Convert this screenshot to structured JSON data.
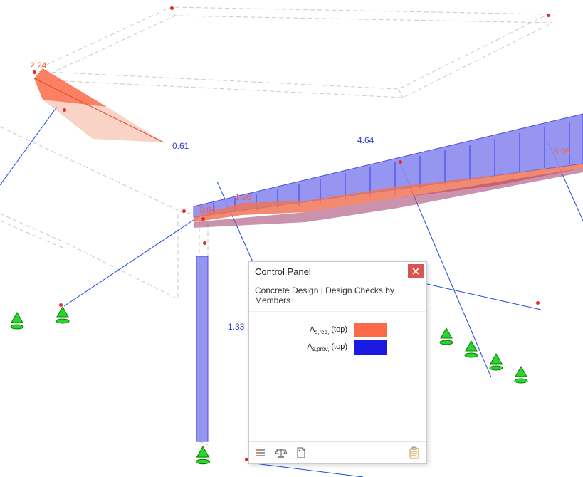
{
  "panel": {
    "title": "Control Panel",
    "subtitle": "Concrete Design | Design Checks by Members",
    "legend": [
      {
        "label": "As,req, (top)",
        "color": "#fc6a48"
      },
      {
        "label": "As,prov, (top)",
        "color": "#1a1ae0"
      }
    ],
    "footer_icons": [
      "list-icon",
      "balance-icon",
      "document-icon",
      "clipboard-icon"
    ]
  },
  "values": {
    "v224": "2.24",
    "v061": "0.61",
    "v004": "0.04",
    "v126": "1.26",
    "v464": "4.64",
    "v005": "0.05",
    "v133": "1.33"
  },
  "colors": {
    "red_fill": "#fc6a48",
    "blue_fill": "#7b7bec",
    "blue_stroke": "#2a3dd6",
    "wire": "#c9c9c9",
    "axis_blue": "#1a4be0",
    "support": "#2ad62a",
    "node": "#e52828"
  }
}
